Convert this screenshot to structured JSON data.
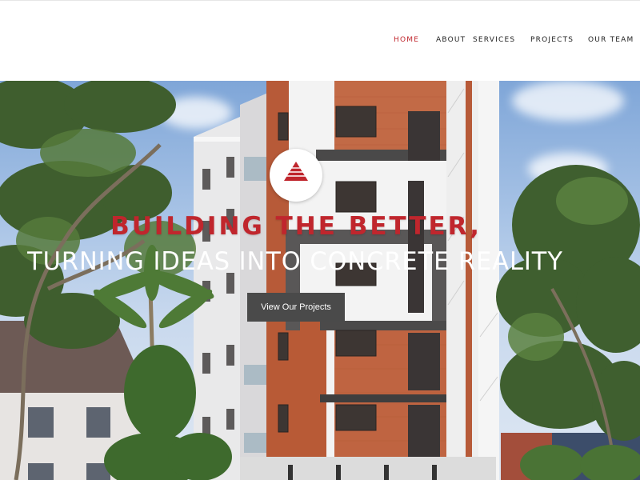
{
  "nav": {
    "items": [
      "HOME",
      "ABOUT",
      "SERVICES",
      "PROJECTS",
      "OUR TEAM"
    ],
    "active_index": 0
  },
  "hero": {
    "headline": "BUILDING THE BETTER,",
    "subheadline": "TURNING IDEAS INTO CONCRETE REALITY",
    "cta_label": "View Our Projects",
    "logo_icon": "triangle-logo-icon"
  },
  "colors": {
    "accent": "#c0262d",
    "cta_bg": "#4a4a4a",
    "nav_text": "#222222"
  }
}
